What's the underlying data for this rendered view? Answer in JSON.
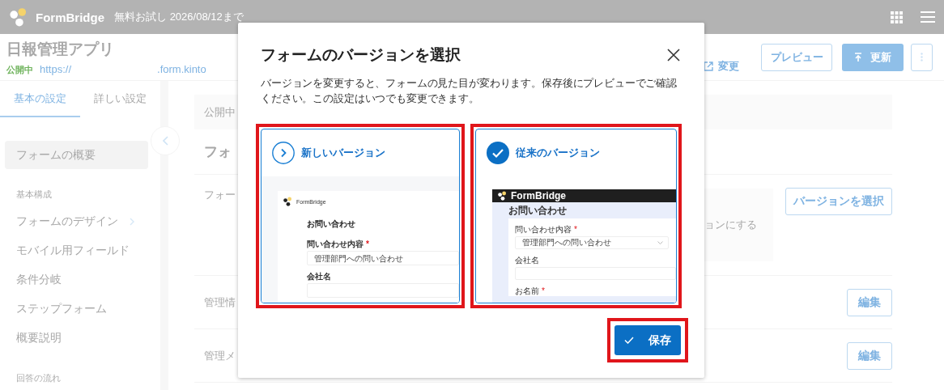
{
  "topbar": {
    "brand": "FormBridge",
    "trial": "無料お試し 2026/08/12まで"
  },
  "app_header": {
    "title": "日報管理アプリ",
    "status": "公開中",
    "url_start": "https://",
    "url_end": ".form.kinto",
    "change_link": "変更",
    "buttons": [
      {
        "kind": "outline",
        "label": "プレビュー"
      },
      {
        "kind": "primary",
        "label": "更新"
      },
      {
        "kind": "more"
      }
    ]
  },
  "sidebar": {
    "tabs": [
      {
        "label": "基本の設定",
        "selected": true
      },
      {
        "label": "詳しい設定",
        "selected": false
      }
    ],
    "sections": [
      {
        "items": [
          {
            "label": "フォームの概要",
            "selected": true,
            "has_submenu": false
          }
        ]
      },
      {
        "heading": "基本構成",
        "items": [
          {
            "label": "フォームのデザイン",
            "selected": false,
            "has_submenu": true
          },
          {
            "label": "モバイル用フィールド",
            "selected": false,
            "has_submenu": false
          },
          {
            "label": "条件分岐",
            "selected": false,
            "has_submenu": false
          },
          {
            "label": "ステップフォーム",
            "selected": false,
            "has_submenu": false
          },
          {
            "label": "概要説明",
            "selected": false,
            "has_submenu": false
          }
        ]
      },
      {
        "heading": "回答の流れ"
      }
    ]
  },
  "main": {
    "banner": "公開中",
    "heading": "フォ",
    "rows": [
      {
        "kind": "version",
        "label": "フォー",
        "note": "ョンにする",
        "button": "バージョンを選択"
      },
      {
        "kind": "edit",
        "label": "管理情",
        "button": "編集"
      },
      {
        "kind": "edit",
        "label": "管理メ",
        "button": "編集"
      }
    ]
  },
  "modal": {
    "title": "フォームのバージョンを選択",
    "description": "バージョンを変更すると、フォームの見た目が変わります。保存後にプレビューでご確認ください。この設定はいつでも変更できます。",
    "options": [
      {
        "label": "新しいバージョン",
        "selected": false,
        "highlighted": true,
        "preview": {
          "kind": "modern",
          "brand": "FormBridge",
          "form_title": "お問い合わせ",
          "fields": [
            {
              "label": "問い合わせ内容",
              "required_mark": "*",
              "value": "管理部門への問い合わせ"
            },
            {
              "label": "会社名"
            }
          ]
        }
      },
      {
        "label": "従来のバージョン",
        "selected": true,
        "highlighted": true,
        "preview": {
          "kind": "classic",
          "brand": "FormBridge",
          "form_title": "お問い合わせ",
          "fields": [
            {
              "label": "問い合わせ内容",
              "required_mark": "*",
              "value": "管理部門への問い合わせ"
            },
            {
              "label": "会社名"
            },
            {
              "label": "お名前",
              "required_mark": "*"
            }
          ]
        }
      }
    ],
    "save": {
      "label": "保存",
      "highlighted": true
    }
  }
}
